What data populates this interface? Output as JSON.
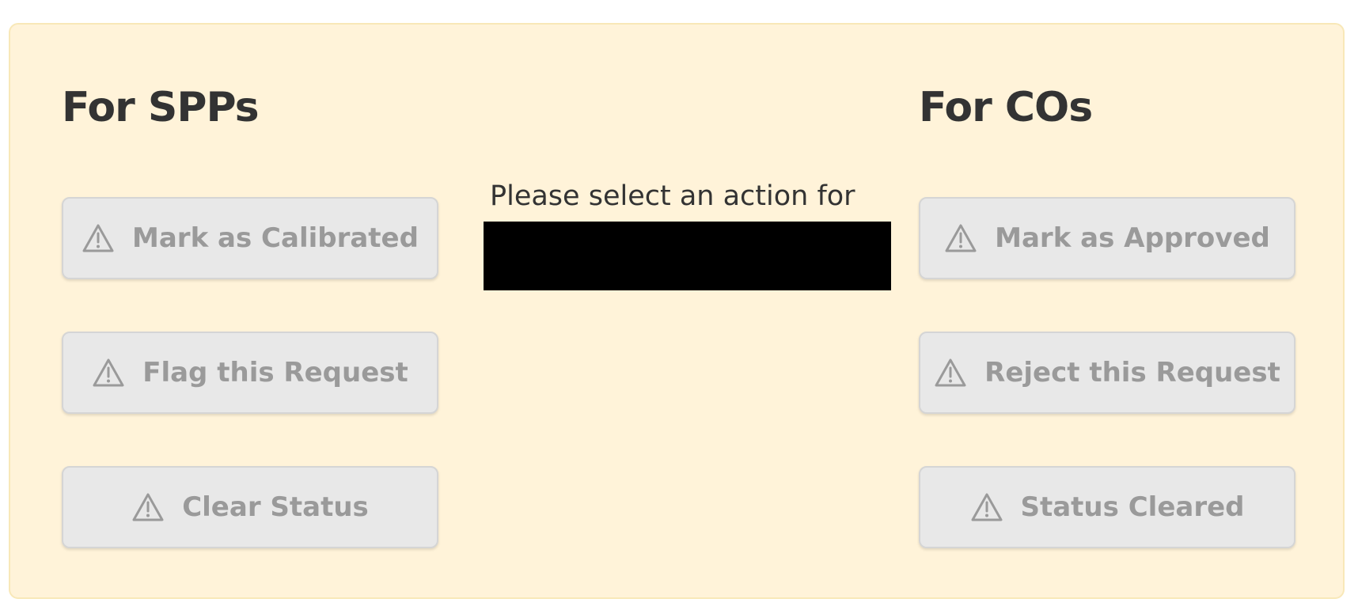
{
  "spp": {
    "heading": "For SPPs",
    "buttons": [
      {
        "label": "Mark as Calibrated",
        "icon": "warning-icon"
      },
      {
        "label": "Flag this Request",
        "icon": "warning-icon"
      },
      {
        "label": "Clear Status",
        "icon": "warning-icon"
      }
    ]
  },
  "co": {
    "heading": "For COs",
    "buttons": [
      {
        "label": "Mark as Approved",
        "icon": "warning-icon"
      },
      {
        "label": "Reject this Request",
        "icon": "warning-icon"
      },
      {
        "label": "Status Cleared",
        "icon": "warning-icon"
      }
    ]
  },
  "center": {
    "prompt": "Please select an action for"
  },
  "colors": {
    "panel_background": "#fff3d9",
    "panel_border": "#f8e8b8",
    "button_background": "#e8e8e8",
    "button_text": "#9a9a9a",
    "heading_text": "#333333",
    "redaction": "#000000"
  }
}
